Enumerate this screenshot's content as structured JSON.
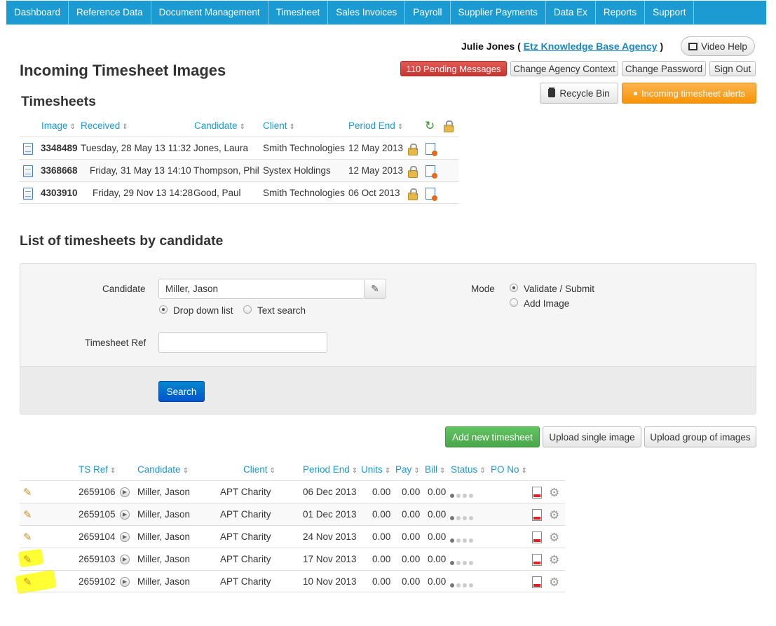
{
  "nav": [
    "Dashboard",
    "Reference Data",
    "Document Management",
    "Timesheet",
    "Sales Invoices",
    "Payroll",
    "Supplier Payments",
    "Data Ex",
    "Reports",
    "Support"
  ],
  "user": {
    "name": "Julie Jones",
    "paren_open": "(",
    "agency": "Etz Knowledge Base Agency",
    "paren_close": ")"
  },
  "buttons": {
    "video_help": "Video Help",
    "pending": "110 Pending Messages",
    "change_agency": "Change Agency Context",
    "change_password": "Change Password",
    "sign_out": "Sign Out",
    "recycle_bin": "Recycle Bin",
    "alerts": "Incoming timesheet alerts",
    "search": "Search",
    "add_new": "Add new timesheet",
    "upload_single": "Upload single image",
    "upload_group": "Upload group of images"
  },
  "page_title": "Incoming Timesheet Images",
  "timesheets": {
    "heading": "Timesheets",
    "columns": {
      "image": "Image",
      "received": "Received",
      "candidate": "Candidate",
      "client": "Client",
      "period_end": "Period End"
    },
    "rows": [
      {
        "image": "3348489",
        "received": "Tuesday, 28 May 13 11:32",
        "candidate": "Jones, Laura",
        "client": "Smith Technologies",
        "period_end": "12 May 2013"
      },
      {
        "image": "3368668",
        "received": "Friday, 31 May 13 14:10",
        "candidate": "Thompson, Phil",
        "client": "Systex Holdings",
        "period_end": "12 May 2013"
      },
      {
        "image": "4303910",
        "received": "Friday, 29 Nov 13 14:28",
        "candidate": "Good, Paul",
        "client": "Smith Technologies",
        "period_end": "06 Oct 2013"
      }
    ]
  },
  "by_candidate": {
    "heading": "List of timesheets by candidate",
    "candidate_label": "Candidate",
    "candidate_value": "Miller, Jason",
    "opt_dropdown": "Drop down list",
    "opt_text": "Text search",
    "mode_label": "Mode",
    "mode_validate": "Validate / Submit",
    "mode_add": "Add Image",
    "ref_label": "Timesheet Ref",
    "ref_value": ""
  },
  "list": {
    "columns": {
      "ts_ref": "TS Ref",
      "candidate": "Candidate",
      "client": "Client",
      "period_end": "Period End",
      "units": "Units",
      "pay": "Pay",
      "bill": "Bill",
      "status": "Status",
      "po_no": "PO No"
    },
    "rows": [
      {
        "ts_ref": "2659106",
        "candidate": "Miller, Jason",
        "client": "APT Charity",
        "period_end": "06 Dec 2013",
        "units": "0.00",
        "pay": "0.00",
        "bill": "0.00"
      },
      {
        "ts_ref": "2659105",
        "candidate": "Miller, Jason",
        "client": "APT Charity",
        "period_end": "01 Dec 2013",
        "units": "0.00",
        "pay": "0.00",
        "bill": "0.00"
      },
      {
        "ts_ref": "2659104",
        "candidate": "Miller, Jason",
        "client": "APT Charity",
        "period_end": "24 Nov 2013",
        "units": "0.00",
        "pay": "0.00",
        "bill": "0.00"
      },
      {
        "ts_ref": "2659103",
        "candidate": "Miller, Jason",
        "client": "APT Charity",
        "period_end": "17 Nov 2013",
        "units": "0.00",
        "pay": "0.00",
        "bill": "0.00"
      },
      {
        "ts_ref": "2659102",
        "candidate": "Miller, Jason",
        "client": "APT Charity",
        "period_end": "10 Nov 2013",
        "units": "0.00",
        "pay": "0.00",
        "bill": "0.00"
      }
    ]
  },
  "icons": {
    "sort": "⇕",
    "film": "film-icon",
    "trash": "trash-icon",
    "bell": "bell-icon",
    "refresh": "refresh-icon",
    "pencil": "✎",
    "gear": "⚙",
    "play": "▶"
  }
}
